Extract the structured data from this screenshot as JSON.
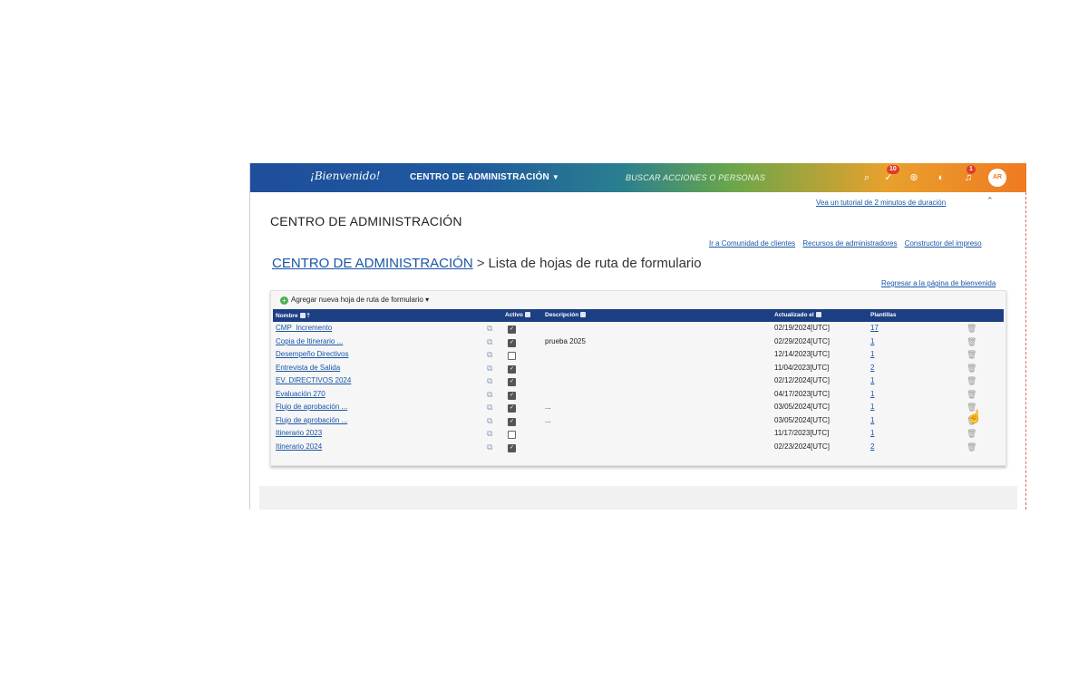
{
  "header": {
    "brand": "¡Bienvenido!",
    "section": "CENTRO DE ADMINISTRACIÓN",
    "search_placeholder": "BUSCAR ACCIONES O PERSONAS",
    "approvals_badge": "10",
    "notifications_badge": "1",
    "avatar": "AR"
  },
  "tutorial_link": "Vea un tutorial de 2 minutos de duración",
  "page_title": "CENTRO DE ADMINISTRACIÓN",
  "top_links": [
    "Ir a Comunidad de clientes",
    "Recursos de administradores",
    "Constructor del impreso"
  ],
  "breadcrumb": {
    "root": "CENTRO DE ADMINISTRACIÓN",
    "separator": ">",
    "current": "Lista de hojas de ruta de formulario"
  },
  "back_link": "Regresar a la página de bienvenida",
  "add_button": "Agregar nueva hoja de ruta de formulario",
  "columns": {
    "name": "Nombre",
    "active": "Activo",
    "description": "Descripción",
    "updated": "Actualizado el",
    "templates": "Plantillas"
  },
  "rows": [
    {
      "name": "CMP_Incremento",
      "active": true,
      "description": "",
      "updated": "02/19/2024[UTC]",
      "templates": "17"
    },
    {
      "name": "Copia de Itinerario ...",
      "active": true,
      "description": "prueba 2025",
      "updated": "02/29/2024[UTC]",
      "templates": "1"
    },
    {
      "name": "Desempeño Directivos",
      "active": false,
      "description": "",
      "updated": "12/14/2023[UTC]",
      "templates": "1"
    },
    {
      "name": "Entrevista de Salida",
      "active": true,
      "description": "",
      "updated": "11/04/2023[UTC]",
      "templates": "2"
    },
    {
      "name": "EV. DIRECTIVOS 2024",
      "active": true,
      "description": "",
      "updated": "02/12/2024[UTC]",
      "templates": "1"
    },
    {
      "name": "Evaluación 270",
      "active": true,
      "description": "",
      "updated": "04/17/2023[UTC]",
      "templates": "1"
    },
    {
      "name": "Flujo de aprobación ...",
      "active": true,
      "description": "...",
      "updated": "03/05/2024[UTC]",
      "templates": "1"
    },
    {
      "name": "Flujo de aprobación ...",
      "active": true,
      "description": "...",
      "updated": "03/05/2024[UTC]",
      "templates": "1"
    },
    {
      "name": "Itinerario 2023",
      "active": false,
      "description": "",
      "updated": "11/17/2023[UTC]",
      "templates": "1"
    },
    {
      "name": "Itinerario 2024",
      "active": true,
      "description": "",
      "updated": "02/23/2024[UTC]",
      "templates": "2"
    }
  ]
}
